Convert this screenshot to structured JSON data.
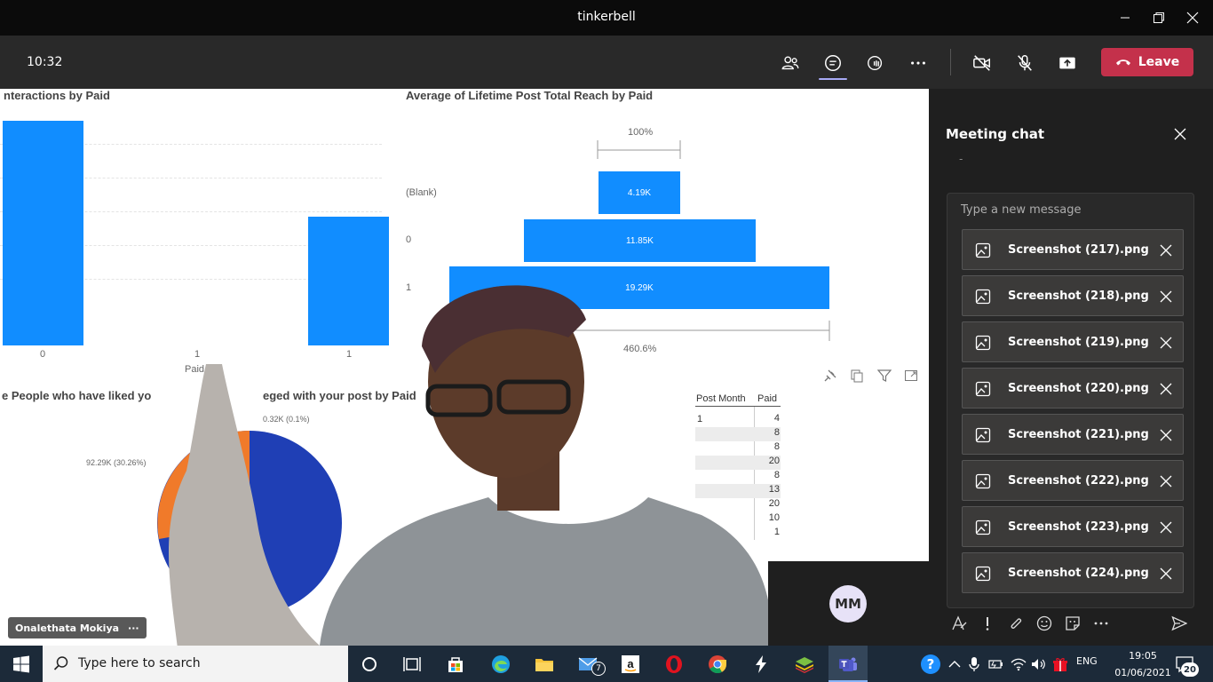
{
  "window": {
    "title": "tinkerbell"
  },
  "toolbar": {
    "time": "10:32",
    "leave_label": "Leave"
  },
  "shared_screen": {
    "chart1": {
      "title": "nteractions by Paid",
      "x_ticks": [
        "0",
        "1",
        "1"
      ],
      "x_label": "Paid"
    },
    "chart2": {
      "title": "Average of Lifetime Post Total Reach by Paid",
      "top_label": "100%",
      "bottom_label": "460.6%",
      "rows": [
        {
          "label": "(Blank)",
          "value_label": "4.19K"
        },
        {
          "label": "0",
          "value_label": "11.85K"
        },
        {
          "label": "1",
          "value_label": "19.29K"
        }
      ]
    },
    "chart3": {
      "title_left": "e People who have liked yo",
      "title_right": "eged with your post by Paid",
      "label_top": "0.32K (0.1%)",
      "label_left": "92.29K (30.26%)"
    },
    "table": {
      "headers": [
        "Post Month",
        "Paid"
      ],
      "first_col": [
        "1"
      ],
      "paid_values": [
        "4",
        "8",
        "8",
        "20",
        "8",
        "13",
        "20",
        "10",
        "1"
      ]
    }
  },
  "participant": {
    "name": "Onalethata Mokiya",
    "more": "···"
  },
  "self": {
    "initials": "MM"
  },
  "chat": {
    "title": "Meeting chat",
    "dash": "-",
    "placeholder": "Type a new message",
    "attachments": [
      "Screenshot (217).png",
      "Screenshot (218).png",
      "Screenshot (219).png",
      "Screenshot (220).png",
      "Screenshot (221).png",
      "Screenshot (222).png",
      "Screenshot (223).png",
      "Screenshot (224).png"
    ]
  },
  "taskbar": {
    "search_placeholder": "Type here to search",
    "mail_badge": "7",
    "lang": "ENG",
    "time": "19:05",
    "date": "01/06/2021",
    "notif_count": "20"
  },
  "colors": {
    "accent": "#6264a7",
    "leave": "#c4314b",
    "powerbi_blue": "#118dff",
    "pie_dark": "#1f3fb5",
    "pie_orange": "#f07a2a"
  }
}
